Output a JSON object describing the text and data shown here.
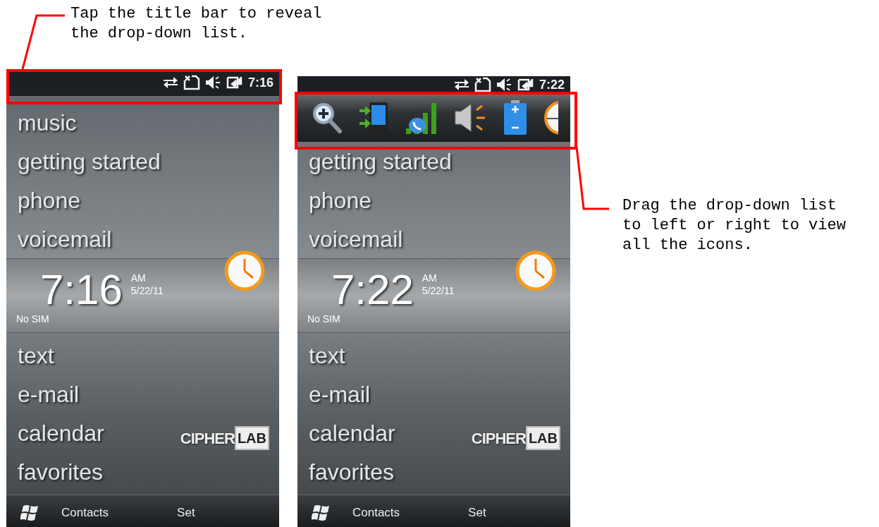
{
  "callouts": [
    {
      "lines": [
        "Tap the title bar to reveal",
        "the drop-down list."
      ]
    },
    {
      "lines": [
        "Drag the drop-down list",
        "to left or right to view",
        "all the icons."
      ]
    }
  ],
  "phones": [
    {
      "status_bar": {
        "time": "7:16"
      },
      "dropdown_open": false,
      "menu_top": [
        "music",
        "getting started",
        "phone",
        "voicemail"
      ],
      "clock": {
        "time": "7:16",
        "ampm": "AM",
        "date": "5/22/11",
        "carrier": "No SIM"
      },
      "menu_bottom": [
        "text",
        "e-mail",
        "calendar",
        "favorites"
      ],
      "logo": {
        "left": "CIPHER",
        "right": "LAB"
      },
      "softkeys": [
        "Contacts",
        "Set"
      ]
    },
    {
      "status_bar": {
        "time": "7:22"
      },
      "dropdown_open": true,
      "menu_top": [
        "getting started",
        "phone",
        "voicemail"
      ],
      "clock": {
        "time": "7:22",
        "ampm": "AM",
        "date": "5/22/11",
        "carrier": "No SIM"
      },
      "menu_bottom": [
        "text",
        "e-mail",
        "calendar",
        "favorites"
      ],
      "logo": {
        "left": "CIPHER",
        "right": "LAB"
      },
      "softkeys": [
        "Contacts",
        "Set"
      ]
    }
  ]
}
